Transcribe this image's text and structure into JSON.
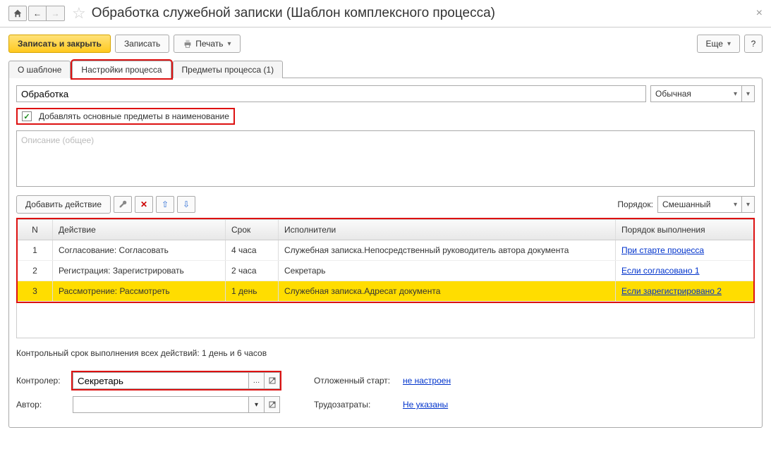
{
  "title": "Обработка служебной записки (Шаблон комплексного процесса)",
  "toolbar": {
    "save_close": "Записать и закрыть",
    "save": "Записать",
    "print": "Печать",
    "more": "Еще",
    "help": "?"
  },
  "tabs": {
    "about": "О шаблоне",
    "settings": "Настройки процесса",
    "subjects": "Предметы процесса (1)"
  },
  "fields": {
    "name_value": "Обработка",
    "importance": "Обычная",
    "add_subjects_checkbox": "Добавлять основные предметы в наименование",
    "description_placeholder": "Описание (общее)"
  },
  "actions_toolbar": {
    "add": "Добавить действие",
    "order_label": "Порядок:",
    "order_value": "Смешанный"
  },
  "table": {
    "headers": {
      "n": "N",
      "action": "Действие",
      "term": "Срок",
      "executors": "Исполнители",
      "order": "Порядок выполнения"
    },
    "rows": [
      {
        "n": "1",
        "action": "Согласование: Согласовать",
        "term": "4 часа",
        "executors": "Служебная записка.Непосредственный руководитель автора документа",
        "order": "При старте процесса"
      },
      {
        "n": "2",
        "action": "Регистрация: Зарегистрировать",
        "term": "2 часа",
        "executors": "Секретарь",
        "order": "Если согласовано 1"
      },
      {
        "n": "3",
        "action": "Рассмотрение: Рассмотреть",
        "term": "1 день",
        "executors": "Служебная записка.Адресат документа",
        "order": "Если зарегистрировано 2"
      }
    ]
  },
  "summary": "Контрольный срок выполнения всех действий:   1 день и 6 часов",
  "footer": {
    "controller_label": "Контролер:",
    "controller_value": "Секретарь",
    "author_label": "Автор:",
    "author_value": "",
    "delayed_start_label": "Отложенный старт:",
    "delayed_start_value": "не настроен",
    "labor_label": "Трудозатраты:",
    "labor_value": "Не указаны"
  }
}
